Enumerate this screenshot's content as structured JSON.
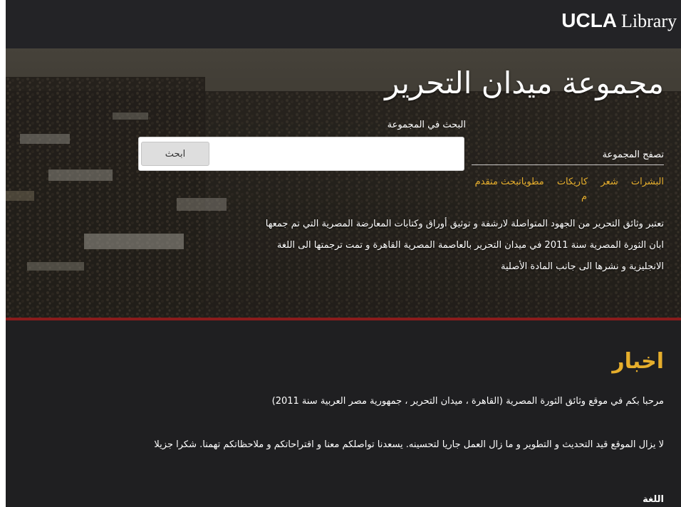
{
  "header": {
    "logo_bold": "UCLA",
    "logo_rest": "Library"
  },
  "hero": {
    "title": "مجموعة ميدان التحرير",
    "search_label": "البحث في المجموعة",
    "search_button": "ابحث",
    "browse_label": "تصفح المجموعة",
    "browse_links": [
      "البشرات",
      "شعر",
      "كاريكات",
      "مطويات"
    ],
    "advanced_search": "بحث متقدم",
    "stray_char": "م",
    "description": "تعتبر وثائق التحرير من الجهود المتواصلة لارشفة و توثيق أوراق وكتابات المعارضة المصرية التي تم جمعها ابان الثورة المصرية سنة 2011 في ميدان التحرير بالعاصمة المصرية القاهرة و تمت ترجمتها الى اللغة الانجليزية و نشرها الى جانب المادة الأصلية"
  },
  "news": {
    "heading": "اخبار",
    "paragraph1": "مرحبا بكم في موقع وثائق الثورة المصرية (القاهرة ، ميدان التحرير ، جمهورية مصر العربية سنة 2011)",
    "paragraph2": "لا يزال الموقع قيد التحديث و التطوير و ما زال العمل جاريا لتحسينه. يسعدنا تواصلكم معنا و اقتراحاتكم و ملاحظاتكم تهمنا. شكرا جزيلا",
    "language_heading": "اللغة"
  },
  "colors": {
    "accent": "#e6ae2c",
    "header_bg": "#232326",
    "page_bg": "#1f1f21",
    "divider": "#8a1c1c"
  }
}
